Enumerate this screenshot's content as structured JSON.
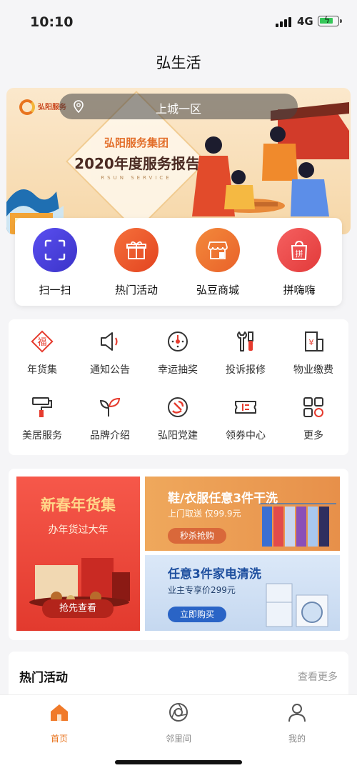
{
  "status": {
    "time": "10:10",
    "network": "4G"
  },
  "nav": {
    "title": "弘生活"
  },
  "banner": {
    "location": "上城一区",
    "logo_text": "弘阳服务",
    "brand": "弘阳服务集团",
    "title": "2020年度服务报告",
    "subtitle_en": "RSUN SERVICE"
  },
  "quick_actions": [
    {
      "label": "扫一扫",
      "icon": "scan-icon",
      "color": "#4a3fd6"
    },
    {
      "label": "热门活动",
      "icon": "gift-icon",
      "color": "#ef5a2b"
    },
    {
      "label": "弘豆商城",
      "icon": "shop-icon",
      "color": "#f0762c"
    },
    {
      "label": "拼嗨嗨",
      "icon": "group-buy-icon",
      "color": "#ef4f4a"
    }
  ],
  "services": [
    {
      "label": "年货集",
      "icon": "fu-icon"
    },
    {
      "label": "通知公告",
      "icon": "speaker-icon"
    },
    {
      "label": "幸运抽奖",
      "icon": "lottery-wheel-icon"
    },
    {
      "label": "投诉报修",
      "icon": "repair-tools-icon"
    },
    {
      "label": "物业缴费",
      "icon": "payment-icon"
    },
    {
      "label": "美居服务",
      "icon": "paint-roller-icon"
    },
    {
      "label": "品牌介绍",
      "icon": "sprout-icon"
    },
    {
      "label": "弘阳党建",
      "icon": "party-emblem-icon"
    },
    {
      "label": "领券中心",
      "icon": "coupon-icon"
    },
    {
      "label": "更多",
      "icon": "more-grid-icon"
    }
  ],
  "promos": {
    "left": {
      "title": "新春年货集",
      "subtitle": "办年货过大年",
      "button": "抢先查看"
    },
    "top_right": {
      "title": "鞋/衣服任意3件干洗",
      "subtitle": "上门取送 仅99.9元",
      "button": "秒杀抢购"
    },
    "bottom_right": {
      "title": "任意3件家电清洗",
      "subtitle": "业主专享价299元",
      "button": "立即购买"
    }
  },
  "hot": {
    "title": "热门活动",
    "more": "查看更多"
  },
  "tabs": [
    {
      "label": "首页",
      "icon": "home-icon",
      "active": true
    },
    {
      "label": "邻里间",
      "icon": "neighborhood-icon",
      "active": false
    },
    {
      "label": "我的",
      "icon": "profile-icon",
      "active": false
    }
  ],
  "colors": {
    "accent": "#e8741f",
    "tab_inactive": "#888888"
  }
}
